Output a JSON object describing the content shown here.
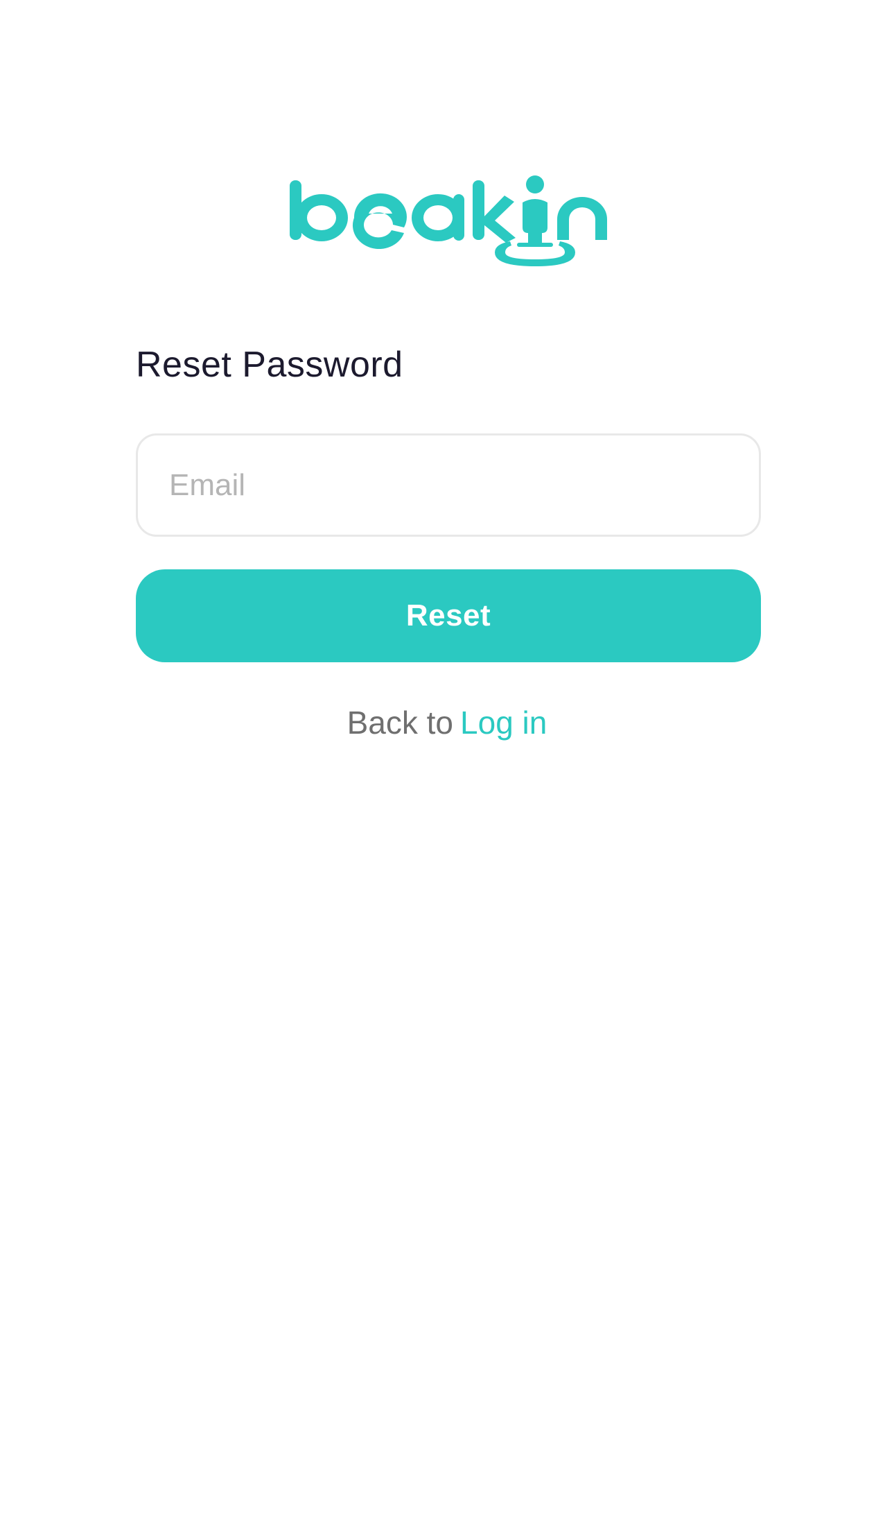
{
  "brand": {
    "logo_text": "beakin",
    "color": "#2bc9c1"
  },
  "page": {
    "title": "Reset Password"
  },
  "form": {
    "email_placeholder": "Email",
    "email_value": "",
    "reset_label": "Reset"
  },
  "footer": {
    "back_text": "Back to",
    "login_label": "Log in"
  },
  "colors": {
    "accent": "#2bc9c1",
    "title_text": "#1c1a2e",
    "muted_text": "#6f6f6f",
    "placeholder": "#b5b5b5",
    "border": "#e8e8e8"
  }
}
